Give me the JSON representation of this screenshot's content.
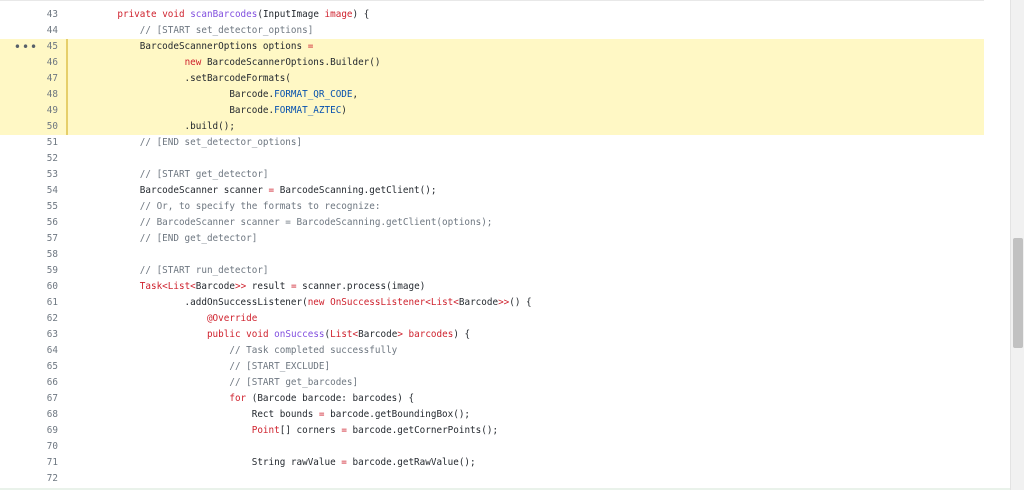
{
  "code_view": {
    "more_icon": "more-horizontal-icon",
    "highlight_color": "#fff8c5",
    "lines": [
      {
        "num": "43",
        "hl": false,
        "segs": [
          {
            "t": "    "
          },
          {
            "t": "private",
            "c": "kw"
          },
          {
            "t": " "
          },
          {
            "t": "void",
            "c": "kw"
          },
          {
            "t": " "
          },
          {
            "t": "scanBarcodes",
            "c": "fn"
          },
          {
            "t": "(InputImage "
          },
          {
            "t": "image",
            "c": "kw"
          },
          {
            "t": ") {"
          }
        ]
      },
      {
        "num": "44",
        "hl": false,
        "segs": [
          {
            "t": "        "
          },
          {
            "t": "// [START set_detector_options]",
            "c": "cm"
          }
        ]
      },
      {
        "num": "45",
        "hl": true,
        "segs": [
          {
            "t": "        BarcodeScannerOptions options "
          },
          {
            "t": "=",
            "c": "kw"
          }
        ]
      },
      {
        "num": "46",
        "hl": true,
        "segs": [
          {
            "t": "                "
          },
          {
            "t": "new",
            "c": "kw"
          },
          {
            "t": " BarcodeScannerOptions.Builder()"
          }
        ]
      },
      {
        "num": "47",
        "hl": true,
        "segs": [
          {
            "t": "                .setBarcodeFormats("
          }
        ]
      },
      {
        "num": "48",
        "hl": true,
        "segs": [
          {
            "t": "                        Barcode."
          },
          {
            "t": "FORMAT_QR_CODE",
            "c": "cn"
          },
          {
            "t": ","
          }
        ]
      },
      {
        "num": "49",
        "hl": true,
        "segs": [
          {
            "t": "                        Barcode."
          },
          {
            "t": "FORMAT_AZTEC",
            "c": "cn"
          },
          {
            "t": ")"
          }
        ]
      },
      {
        "num": "50",
        "hl": true,
        "segs": [
          {
            "t": "                .build();"
          }
        ]
      },
      {
        "num": "51",
        "hl": false,
        "segs": [
          {
            "t": "        "
          },
          {
            "t": "// [END set_detector_options]",
            "c": "cm"
          }
        ]
      },
      {
        "num": "52",
        "hl": false,
        "segs": [
          {
            "t": ""
          }
        ]
      },
      {
        "num": "53",
        "hl": false,
        "segs": [
          {
            "t": "        "
          },
          {
            "t": "// [START get_detector]",
            "c": "cm"
          }
        ]
      },
      {
        "num": "54",
        "hl": false,
        "segs": [
          {
            "t": "        BarcodeScanner scanner "
          },
          {
            "t": "=",
            "c": "kw"
          },
          {
            "t": " BarcodeScanning.getClient();"
          }
        ]
      },
      {
        "num": "55",
        "hl": false,
        "segs": [
          {
            "t": "        "
          },
          {
            "t": "// Or, to specify the formats to recognize:",
            "c": "cm"
          }
        ]
      },
      {
        "num": "56",
        "hl": false,
        "segs": [
          {
            "t": "        "
          },
          {
            "t": "// BarcodeScanner scanner = BarcodeScanning.getClient(options);",
            "c": "cm"
          }
        ]
      },
      {
        "num": "57",
        "hl": false,
        "segs": [
          {
            "t": "        "
          },
          {
            "t": "// [END get_detector]",
            "c": "cm"
          }
        ]
      },
      {
        "num": "58",
        "hl": false,
        "segs": [
          {
            "t": ""
          }
        ]
      },
      {
        "num": "59",
        "hl": false,
        "segs": [
          {
            "t": "        "
          },
          {
            "t": "// [START run_detector]",
            "c": "cm"
          }
        ]
      },
      {
        "num": "60",
        "hl": false,
        "segs": [
          {
            "t": "        "
          },
          {
            "t": "Task",
            "c": "tp"
          },
          {
            "t": "<",
            "c": "kw"
          },
          {
            "t": "List",
            "c": "tp"
          },
          {
            "t": "<",
            "c": "kw"
          },
          {
            "t": "Barcode"
          },
          {
            "t": ">>",
            "c": "kw"
          },
          {
            "t": " result "
          },
          {
            "t": "=",
            "c": "kw"
          },
          {
            "t": " scanner.process(image)"
          }
        ]
      },
      {
        "num": "61",
        "hl": false,
        "segs": [
          {
            "t": "                .addOnSuccessListener("
          },
          {
            "t": "new",
            "c": "kw"
          },
          {
            "t": " "
          },
          {
            "t": "OnSuccessListener",
            "c": "tp"
          },
          {
            "t": "<",
            "c": "kw"
          },
          {
            "t": "List",
            "c": "tp"
          },
          {
            "t": "<",
            "c": "kw"
          },
          {
            "t": "Barcode"
          },
          {
            "t": ">>",
            "c": "kw"
          },
          {
            "t": "() {"
          }
        ]
      },
      {
        "num": "62",
        "hl": false,
        "segs": [
          {
            "t": "                    "
          },
          {
            "t": "@Override",
            "c": "kw"
          }
        ]
      },
      {
        "num": "63",
        "hl": false,
        "segs": [
          {
            "t": "                    "
          },
          {
            "t": "public",
            "c": "kw"
          },
          {
            "t": " "
          },
          {
            "t": "void",
            "c": "kw"
          },
          {
            "t": " "
          },
          {
            "t": "onSuccess",
            "c": "fn"
          },
          {
            "t": "("
          },
          {
            "t": "List",
            "c": "tp"
          },
          {
            "t": "<",
            "c": "kw"
          },
          {
            "t": "Barcode"
          },
          {
            "t": ">",
            "c": "kw"
          },
          {
            "t": " "
          },
          {
            "t": "barcodes",
            "c": "kw"
          },
          {
            "t": ") {"
          }
        ]
      },
      {
        "num": "64",
        "hl": false,
        "segs": [
          {
            "t": "                        "
          },
          {
            "t": "// Task completed successfully",
            "c": "cm"
          }
        ]
      },
      {
        "num": "65",
        "hl": false,
        "segs": [
          {
            "t": "                        "
          },
          {
            "t": "// [START_EXCLUDE]",
            "c": "cm"
          }
        ]
      },
      {
        "num": "66",
        "hl": false,
        "segs": [
          {
            "t": "                        "
          },
          {
            "t": "// [START get_barcodes]",
            "c": "cm"
          }
        ]
      },
      {
        "num": "67",
        "hl": false,
        "segs": [
          {
            "t": "                        "
          },
          {
            "t": "for",
            "c": "kw"
          },
          {
            "t": " (Barcode barcode: barcodes) {"
          }
        ]
      },
      {
        "num": "68",
        "hl": false,
        "segs": [
          {
            "t": "                            Rect bounds "
          },
          {
            "t": "=",
            "c": "kw"
          },
          {
            "t": " barcode.getBoundingBox();"
          }
        ]
      },
      {
        "num": "69",
        "hl": false,
        "segs": [
          {
            "t": "                            "
          },
          {
            "t": "Point",
            "c": "tp"
          },
          {
            "t": "[] corners "
          },
          {
            "t": "=",
            "c": "kw"
          },
          {
            "t": " barcode.getCornerPoints();"
          }
        ]
      },
      {
        "num": "70",
        "hl": false,
        "segs": [
          {
            "t": ""
          }
        ]
      },
      {
        "num": "71",
        "hl": false,
        "segs": [
          {
            "t": "                            String rawValue "
          },
          {
            "t": "=",
            "c": "kw"
          },
          {
            "t": " barcode.getRawValue();"
          }
        ]
      },
      {
        "num": "72",
        "hl": false,
        "segs": [
          {
            "t": ""
          }
        ]
      }
    ]
  }
}
